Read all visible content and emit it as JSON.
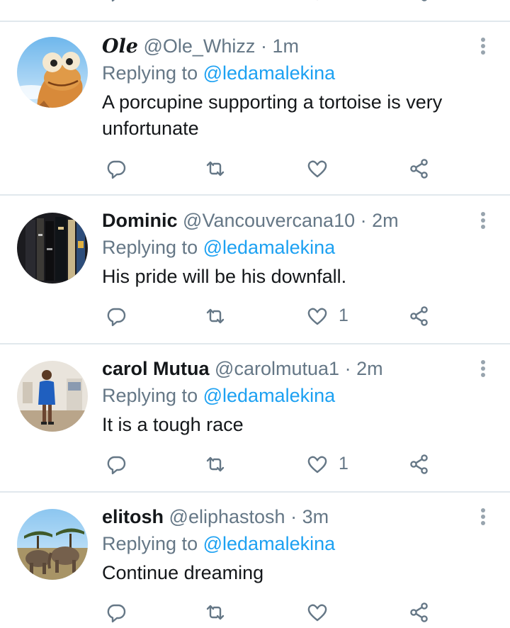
{
  "replying_prefix": "Replying to",
  "icons": {
    "reply": "reply-icon",
    "retweet": "retweet-icon",
    "like": "heart-icon",
    "share": "share-icon",
    "more": "more-vertical-icon"
  },
  "colors": {
    "link": "#1da1f2",
    "muted": "#657786",
    "text": "#14171a",
    "divider": "#e1e8ed"
  },
  "tweets": [
    {
      "display_name": "𝑶𝒍𝒆",
      "handle": "@Ole_Whizz",
      "separator": "·",
      "time": "1m",
      "replying_to": "@ledamalekina",
      "text": "A porcupine supporting a tortoise is very unfortunate",
      "likes": ""
    },
    {
      "display_name": "Dominic",
      "handle": "@Vancouvercana10",
      "separator": "·",
      "time": "2m",
      "replying_to": "@ledamalekina",
      "text": "His pride will be his downfall.",
      "likes": "1"
    },
    {
      "display_name": "carol Mutua",
      "handle": "@carolmutua1",
      "separator": "·",
      "time": "2m",
      "replying_to": "@ledamalekina",
      "text": "It is a tough race",
      "likes": "1"
    },
    {
      "display_name": "elitosh",
      "handle": "@eliphastosh",
      "separator": "·",
      "time": "3m",
      "replying_to": "@ledamalekina",
      "text": "Continue dreaming",
      "likes": ""
    }
  ]
}
